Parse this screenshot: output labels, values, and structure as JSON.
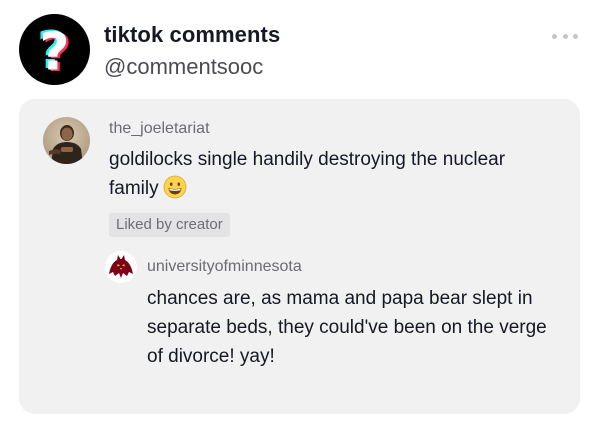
{
  "post": {
    "account_name": "tiktok comments",
    "account_handle": "@commentsooc",
    "avatar_icon": "question-mark-icon",
    "more_icon": "more-dots-icon"
  },
  "comment": {
    "username": "the_joeletariat",
    "text": "goldilocks single handily destroying the nuclear family",
    "emoji": "grinning-face-icon",
    "liked_label": "Liked by creator"
  },
  "reply": {
    "username": "universityofminnesota",
    "text": "chances are, as mama and papa bear slept in separate beds, they could've been on the verge of divorce! yay!",
    "avatar_icon": "gopher-logo-icon"
  },
  "colors": {
    "background": "#ffffff",
    "card": "#f1f1f2",
    "cyan": "#25f4ee",
    "red": "#fe2c55",
    "gopher_maroon": "#7a0019"
  }
}
